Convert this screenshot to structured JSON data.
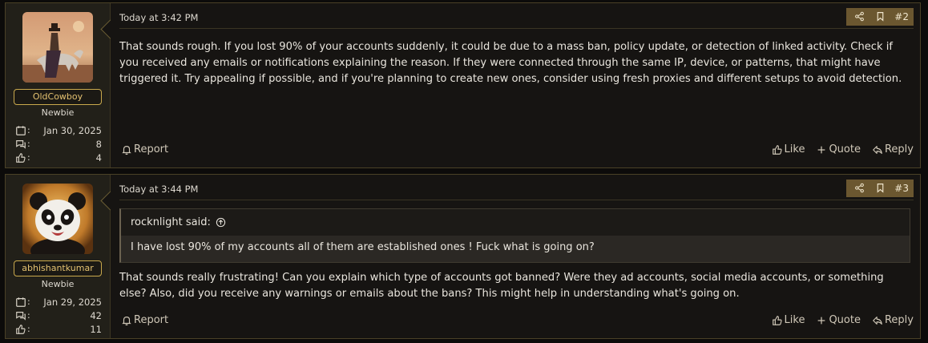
{
  "posts": [
    {
      "user": {
        "name": "OldCowboy",
        "role": "Newbie",
        "joined": "Jan 30, 2025",
        "messages": "8",
        "reactions": "4"
      },
      "date": "Today at 3:42 PM",
      "number": "#2",
      "message": "That sounds rough. If you lost 90% of your accounts suddenly, it could be due to a mass ban, policy update, or detection of linked activity. Check if you received any emails or notifications explaining the reason. If they were connected through the same IP, device, or patterns, that might have triggered it. Try appealing if possible, and if you're planning to create new ones, consider using fresh proxies and different setups to avoid detection.",
      "actions": {
        "report": "Report",
        "like": "Like",
        "quote": "Quote",
        "reply": "Reply"
      }
    },
    {
      "user": {
        "name": "abhishantkumar",
        "role": "Newbie",
        "joined": "Jan 29, 2025",
        "messages": "42",
        "reactions": "11"
      },
      "date": "Today at 3:44 PM",
      "number": "#3",
      "quote": {
        "author": "rocknlight said:",
        "text": "I have lost 90% of my accounts all of them are established ones ! Fuck what is going on?"
      },
      "message": "That sounds really frustrating! Can you explain which type of accounts got banned? Were they ad accounts, social media accounts, or something else? Also, did you receive any warnings or emails about the bans? This might help in understanding what's going on.",
      "actions": {
        "report": "Report",
        "like": "Like",
        "quote": "Quote",
        "reply": "Reply"
      }
    }
  ],
  "colors": {
    "accent_gold": "#e3c170",
    "tools_bar": "#6b5730",
    "background": "#161412"
  }
}
